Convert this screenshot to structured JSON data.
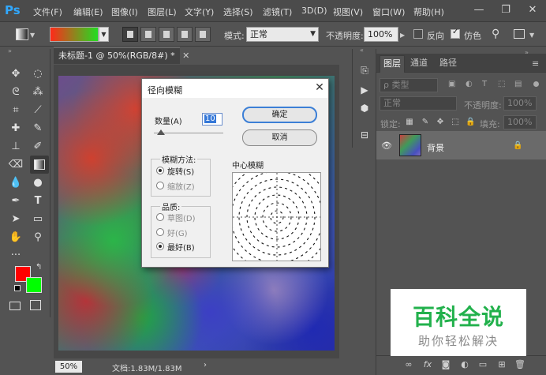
{
  "app": {
    "logo": "Ps"
  },
  "menu": [
    "文件(F)",
    "编辑(E)",
    "图像(I)",
    "图层(L)",
    "文字(Y)",
    "选择(S)",
    "滤镜(T)",
    "3D(D)",
    "视图(V)",
    "窗口(W)",
    "帮助(H)"
  ],
  "window_controls": [
    "—",
    "❐",
    "✕"
  ],
  "options": {
    "mode_label": "模式:",
    "mode_value": "正常",
    "opacity_label": "不透明度:",
    "opacity_value": "100%",
    "reverse_label": "反向",
    "dither_label": "仿色",
    "reverse_checked": false,
    "dither_checked": true,
    "gradient_colors": [
      "#ff2a1a",
      "#22dd22"
    ]
  },
  "tools": [
    "move-icon",
    "marquee-icon",
    "lasso-icon",
    "magic-wand-icon",
    "crop-icon",
    "eyedropper-icon",
    "healing-icon",
    "brush-icon",
    "stamp-icon",
    "history-brush-icon",
    "eraser-icon",
    "gradient-icon",
    "blur-icon",
    "dodge-icon",
    "pen-icon",
    "type-icon",
    "path-select-icon",
    "rectangle-icon",
    "hand-icon",
    "zoom-icon",
    "more-icon"
  ],
  "colors": {
    "foreground": "#ff0000",
    "background": "#00ff00"
  },
  "document": {
    "tab_title": "未标题-1 @ 50%(RGB/8#) *",
    "zoom": "50%",
    "doc_info": "文档:1.83M/1.83M",
    "status_arrow": "›"
  },
  "layers_panel": {
    "tabs": [
      "图层",
      "通道",
      "路径"
    ],
    "kind_filter": "ρ 类型",
    "blend_mode": "正常",
    "opacity_label": "不透明度:",
    "opacity_value": "100%",
    "lock_label": "锁定:",
    "fill_label": "填充:",
    "fill_value": "100%",
    "layer_name": "背景"
  },
  "dialog": {
    "title": "径向模糊",
    "amount_label": "数量(A)",
    "amount_value": "10",
    "ok_label": "确定",
    "cancel_label": "取消",
    "method_title": "模糊方法:",
    "method_spin": "旋转(S)",
    "method_zoom": "缩放(Z)",
    "quality_title": "品质:",
    "quality_draft": "草图(D)",
    "quality_good": "好(G)",
    "quality_best": "最好(B)",
    "preview_title": "中心模糊",
    "selected_method": "spin",
    "selected_quality": "best"
  },
  "watermark": {
    "title": "百科全说",
    "subtitle": "助你轻松解决"
  }
}
